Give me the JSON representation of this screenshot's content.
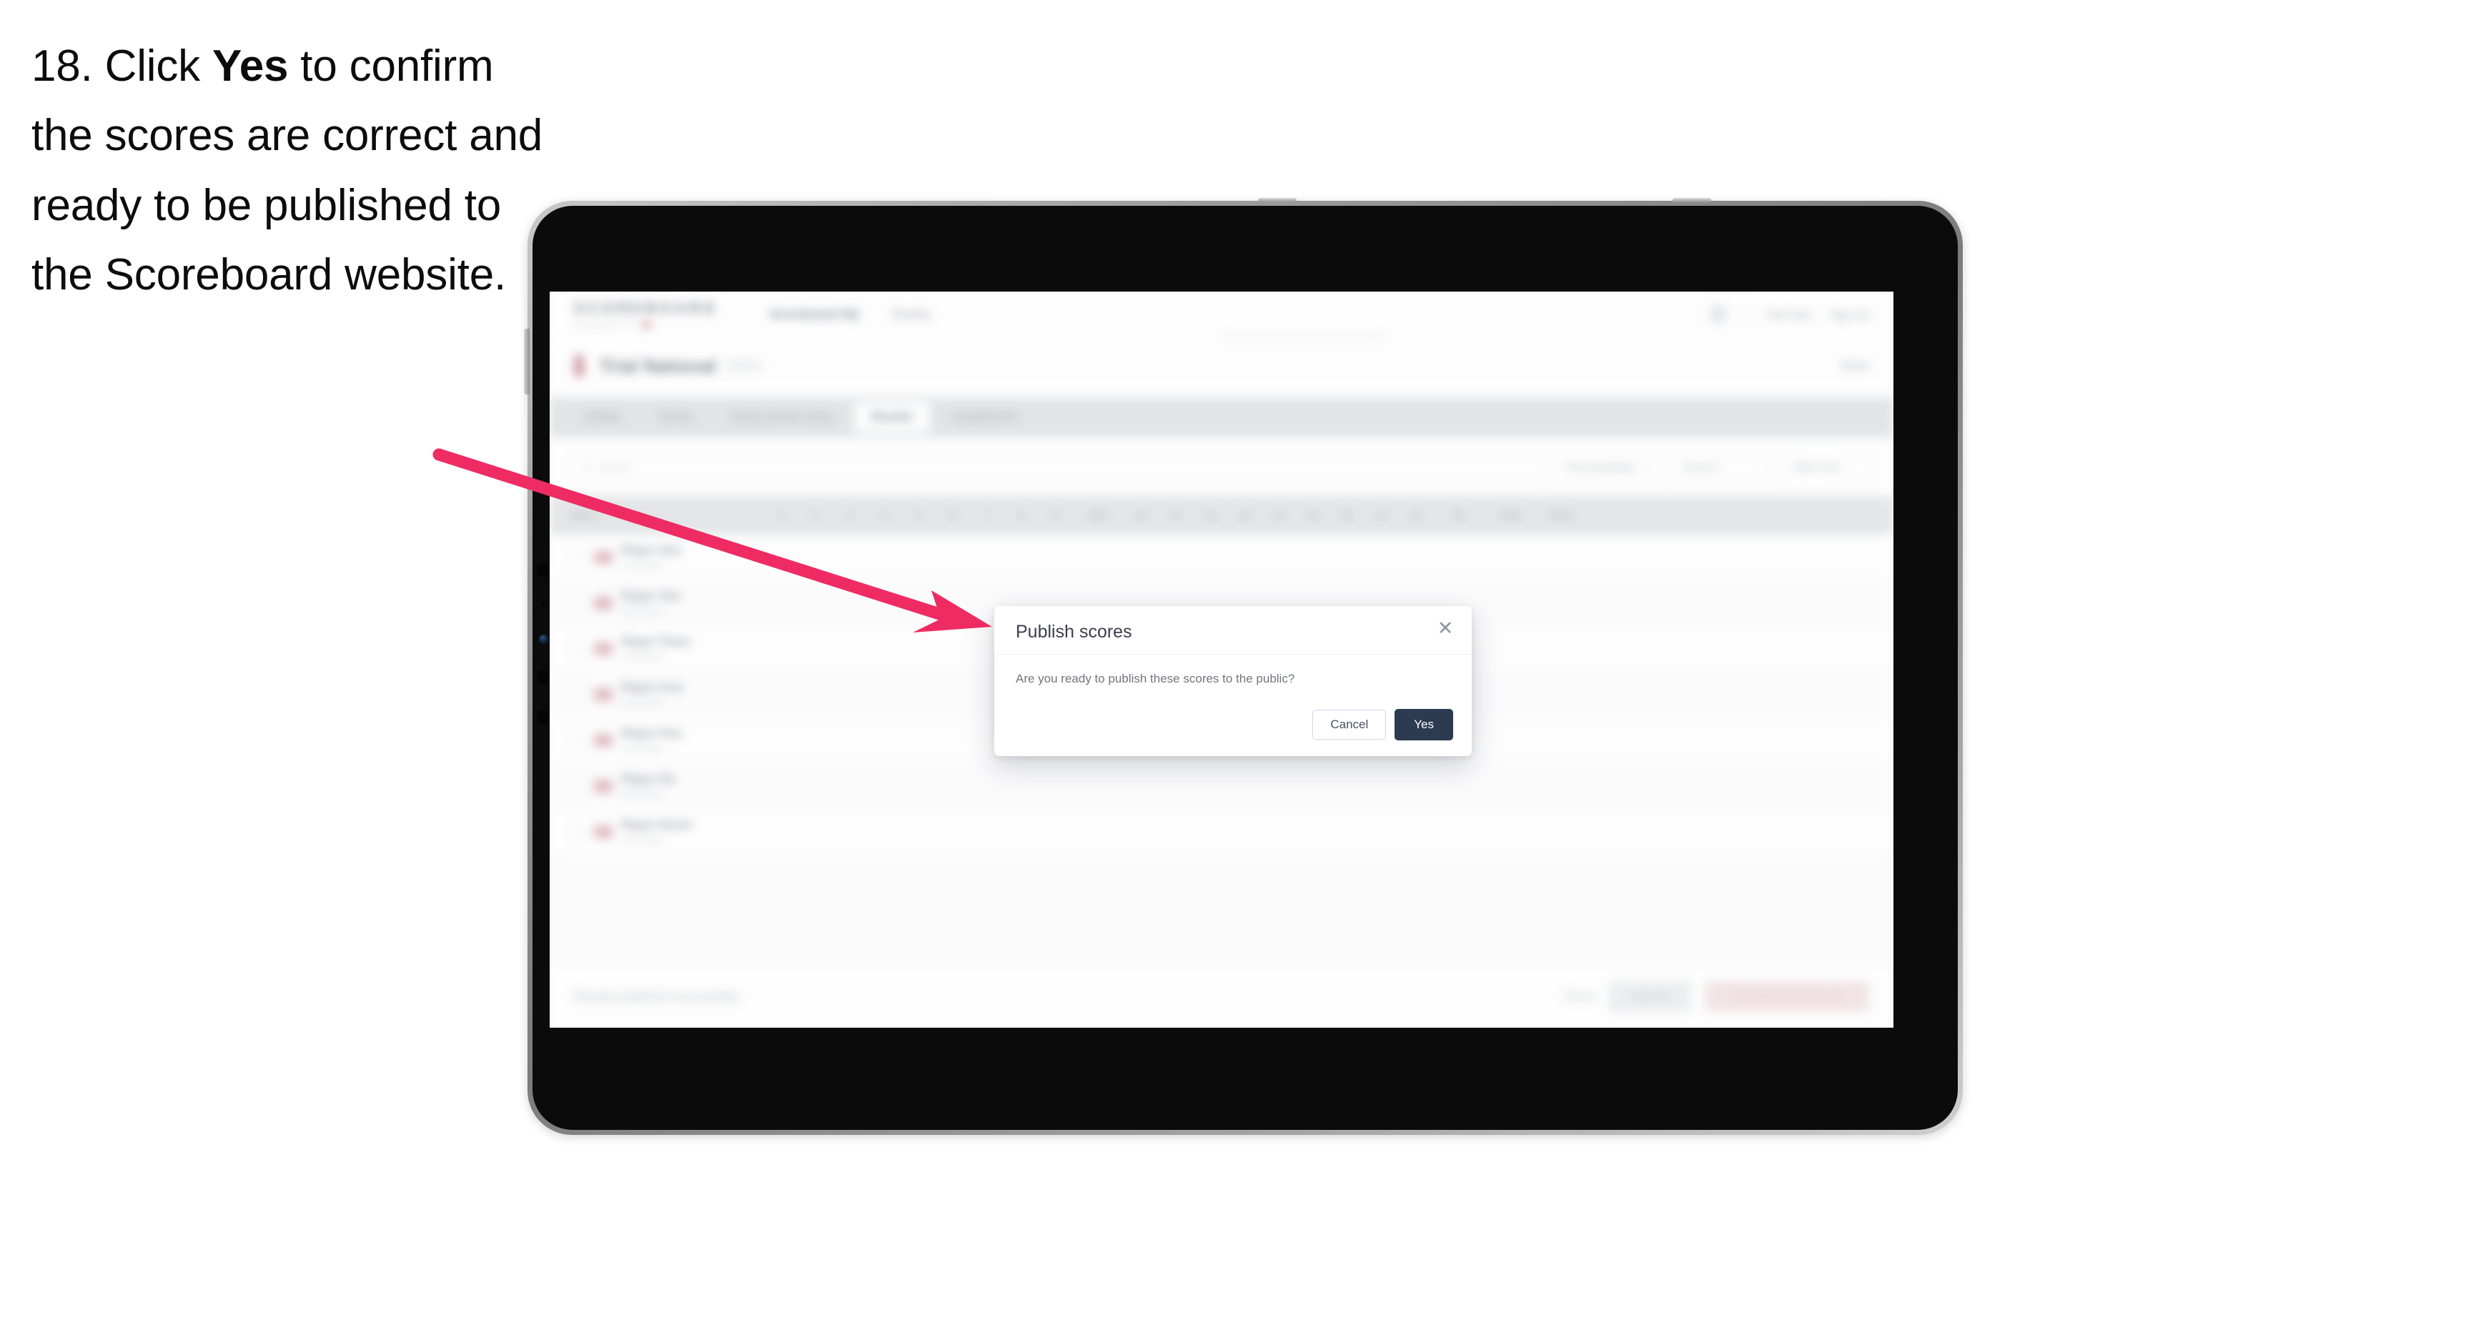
{
  "caption": {
    "number": "18.",
    "pre": "Click ",
    "emphasis": "Yes",
    "post": " to confirm the scores are correct and ready to be published to the Scoreboard website."
  },
  "colors": {
    "arrow": "#EE2C63",
    "primary_button": "#2D3B50",
    "brand_accent": "#F05171",
    "device_bezel": "#0B0B0B",
    "device_frame": "#9D9D9D"
  },
  "device": {
    "type": "tablet",
    "orientation": "landscape"
  },
  "app": {
    "brand": {
      "name": "SCOREBOARD",
      "tagline": "POWERED BY",
      "dot_icon": "brand-mark"
    },
    "top_nav": [
      {
        "label": "Scoreboard HQ",
        "active": true
      },
      {
        "label": "Events",
        "active": false
      }
    ],
    "top_right": [
      {
        "label": "Test User"
      },
      {
        "label": "Sign out"
      }
    ],
    "event": {
      "flag_icon": "event-flag-icon",
      "title": "Trial National",
      "subtitle": "2024",
      "back_label": "Back"
    },
    "tabs": [
      {
        "label": "Details",
        "active": false
      },
      {
        "label": "Teams",
        "active": false
      },
      {
        "label": "Entries &amp; Draw",
        "active": false
      },
      {
        "label": "Results",
        "active": true
      },
      {
        "label": "Leaderboard",
        "active": false
      }
    ],
    "filters": {
      "search_placeholder": "Search",
      "search_icon": "search-icon",
      "selects": [
        {
          "label": "Final Standings",
          "caret_icon": "chevron-down-icon"
        },
        {
          "label": "Round 1",
          "caret_icon": "chevron-down-icon"
        }
      ],
      "toggle_label": "Table Only",
      "icon_button": "columns-icon"
    },
    "table": {
      "columns": [
        {
          "key": "check",
          "label": "",
          "width": "check"
        },
        {
          "key": "player",
          "label": "Player",
          "width": "player"
        },
        {
          "key": "c1",
          "label": "1",
          "width": "num"
        },
        {
          "key": "c2",
          "label": "2",
          "width": "num"
        },
        {
          "key": "c3",
          "label": "3",
          "width": "num"
        },
        {
          "key": "c4",
          "label": "4",
          "width": "num"
        },
        {
          "key": "c5",
          "label": "5",
          "width": "num"
        },
        {
          "key": "c6",
          "label": "6",
          "width": "num"
        },
        {
          "key": "c7",
          "label": "7",
          "width": "num"
        },
        {
          "key": "c8",
          "label": "8",
          "width": "num"
        },
        {
          "key": "c9",
          "label": "9",
          "width": "num"
        },
        {
          "key": "out",
          "label": "OUT",
          "width": "wide"
        },
        {
          "key": "c10",
          "label": "10",
          "width": "num"
        },
        {
          "key": "c11",
          "label": "11",
          "width": "num"
        },
        {
          "key": "c12",
          "label": "12",
          "width": "num"
        },
        {
          "key": "c13",
          "label": "13",
          "width": "num"
        },
        {
          "key": "c14",
          "label": "14",
          "width": "num"
        },
        {
          "key": "c15",
          "label": "15",
          "width": "num"
        },
        {
          "key": "c16",
          "label": "16",
          "width": "num"
        },
        {
          "key": "c17",
          "label": "17",
          "width": "num"
        },
        {
          "key": "c18",
          "label": "18",
          "width": "num"
        },
        {
          "key": "in",
          "label": "IN",
          "width": "wide"
        },
        {
          "key": "total",
          "label": "Total",
          "width": "wide"
        },
        {
          "key": "score",
          "label": "Score",
          "width": "wide"
        }
      ],
      "rows": [
        {
          "flag": "flag-icon",
          "name": "Player One",
          "club": "Club Name"
        },
        {
          "flag": "flag-icon",
          "name": "Player Two",
          "club": "Club Name"
        },
        {
          "flag": "flag-icon",
          "name": "Player Three",
          "club": "Club Name"
        },
        {
          "flag": "flag-icon",
          "name": "Player Four",
          "club": "Club Name"
        },
        {
          "flag": "flag-icon",
          "name": "Player Five",
          "club": "Club Name"
        },
        {
          "flag": "flag-icon",
          "name": "Player Six",
          "club": "Club Name"
        },
        {
          "flag": "flag-icon",
          "name": "Player Seven",
          "club": "Club Name"
        }
      ]
    },
    "footer": {
      "note": "Results published successfully",
      "link": "Reset",
      "secondary_button": "Save All",
      "primary_button": "Publish scores to public"
    }
  },
  "modal": {
    "title": "Publish scores",
    "close_icon": "close-icon",
    "body": "Are you ready to publish these scores to the public?",
    "cancel_label": "Cancel",
    "confirm_label": "Yes"
  }
}
